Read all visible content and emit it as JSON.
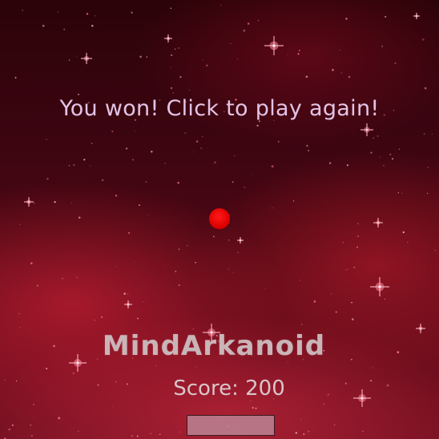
{
  "game": {
    "message": "You won! Click to play again!",
    "title": "MindArkanoid",
    "score_label": "Score:",
    "score_value": "200"
  },
  "colors": {
    "ball": "#e00000",
    "message": "#e3c3e6",
    "title": "#c9b5b8",
    "paddle": "#be96a5"
  }
}
